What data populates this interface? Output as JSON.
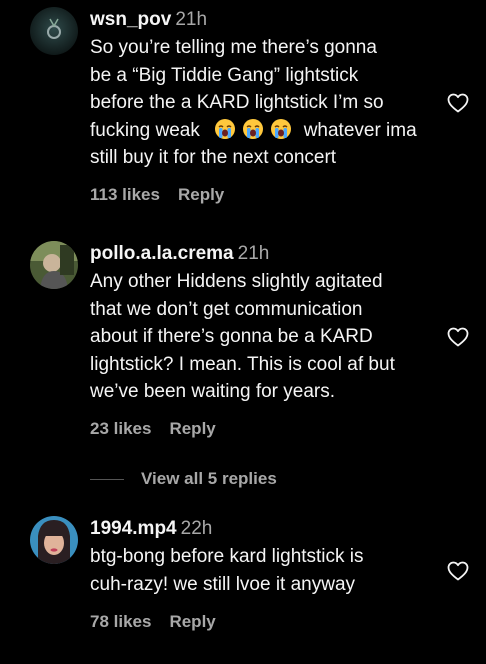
{
  "comments": [
    {
      "username": "wsn_pov",
      "time": "21h",
      "lines": [
        "So you’re telling me there’s gonna",
        "be a “Big Tiddie Gang” lightstick",
        "before the a KARD lightstick I’m so",
        "fucking weak",
        "whatever ima",
        "still buy it for the next concert"
      ],
      "emojis": [
        "crying-face-emoji",
        "crying-face-emoji",
        "crying-face-emoji"
      ],
      "likes": "113 likes",
      "reply": "Reply"
    },
    {
      "username": "pollo.a.la.crema",
      "time": "21h",
      "lines": [
        "Any other Hiddens slightly agitated",
        "that we don’t get communication",
        "about if there’s gonna be a KARD",
        "lightstick? I mean. This is cool af but",
        "we’ve been waiting for years."
      ],
      "likes": "23 likes",
      "reply": "Reply"
    },
    {
      "username": "1994.mp4",
      "time": "22h",
      "lines": [
        "btg-bong before kard lightstick is",
        "cuh-razy! we still lvoe it anyway"
      ],
      "likes": "78 likes",
      "reply": "Reply"
    }
  ],
  "view_replies": "View all 5 replies",
  "icons": {
    "like": "heart-outline-icon"
  },
  "colors": {
    "background": "#000000",
    "text": "#f5f5f5",
    "secondary": "#a8a8a8"
  }
}
